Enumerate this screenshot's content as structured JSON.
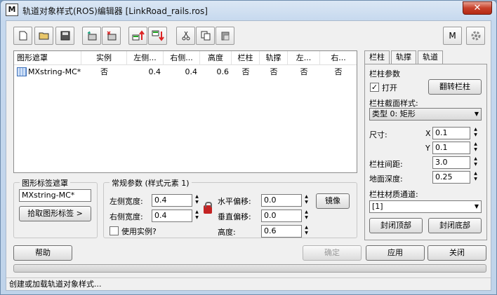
{
  "window": {
    "app_icon": "M",
    "title": "轨道对象样式(ROS)编辑器 [LinkRoad_rails.ros]",
    "close_label": "✕"
  },
  "toolbar": {
    "buttons": [
      "new-icon",
      "open-icon",
      "save-icon",
      "add-element-icon",
      "delete-element-icon",
      "move-up-icon",
      "move-down-icon",
      "cut-icon",
      "copy-icon",
      "paste-icon"
    ],
    "right_buttons": [
      "m-icon",
      "settings-icon"
    ],
    "m_label": "M"
  },
  "table": {
    "headers": [
      "图形遮罩",
      "实例",
      "左侧...",
      "右侧...",
      "高度",
      "栏柱",
      "轨撑",
      "左...",
      "右..."
    ],
    "rows": [
      [
        "MXstring-MC*",
        "否",
        "0.4",
        "0.4",
        "0.6",
        "否",
        "否",
        "否",
        "否"
      ]
    ]
  },
  "shape_mask": {
    "title": "图形标签遮罩",
    "value": "MXstring-MC*",
    "pick_button": "拾取图形标签 >"
  },
  "params": {
    "title": "常规参数 (样式元素 1)",
    "left_width_label": "左侧宽度:",
    "left_width": "0.4",
    "right_width_label": "右侧宽度:",
    "right_width": "0.4",
    "use_instance_label": "使用实例?",
    "h_offset_label": "水平偏移:",
    "h_offset": "0.0",
    "v_offset_label": "垂直偏移:",
    "v_offset": "0.0",
    "height_label": "高度:",
    "height": "0.6",
    "mirror_button": "镜像"
  },
  "tabs": [
    "栏柱",
    "轨撑",
    "轨道"
  ],
  "panel": {
    "title": "栏柱参数",
    "open_label": "打开",
    "open_checked": "✓",
    "flip_button": "翻转栏柱",
    "section_label": "栏柱截面样式:",
    "section_value": "类型 0: 矩形",
    "size_label": "尺寸:",
    "x_label": "X",
    "x_value": "0.1",
    "y_label": "Y",
    "y_value": "0.1",
    "spacing_label": "栏柱间距:",
    "spacing_value": "3.0",
    "depth_label": "地面深度:",
    "depth_value": "0.25",
    "material_label": "栏柱材质通道:",
    "material_value": "[1]",
    "cap_top_button": "封闭顶部",
    "cap_bottom_button": "封闭底部"
  },
  "footer": {
    "help": "帮助",
    "ok": "确定",
    "apply": "应用",
    "close": "关闭"
  },
  "status": "创建或加载轨道对象样式..."
}
